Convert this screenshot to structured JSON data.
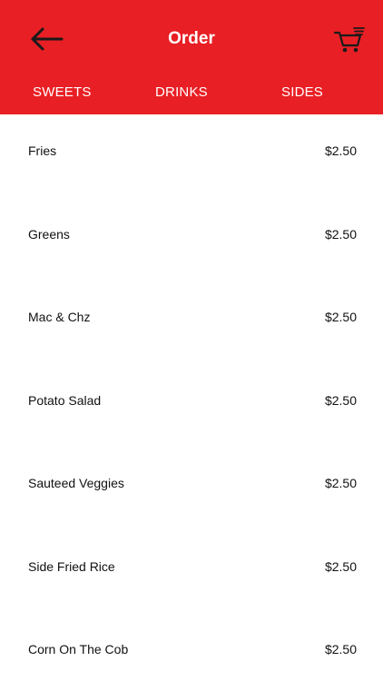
{
  "header": {
    "title": "Order",
    "background_color": "#e81f24",
    "back_icon": "arrow-left-icon",
    "cart_icon": "shopping-cart-icon"
  },
  "tabs": [
    {
      "label": "SWEETS"
    },
    {
      "label": "DRINKS"
    },
    {
      "label": "SIDES"
    }
  ],
  "items": [
    {
      "name": "Fries",
      "price": "$2.50"
    },
    {
      "name": "Greens",
      "price": "$2.50"
    },
    {
      "name": "Mac & Chz",
      "price": "$2.50"
    },
    {
      "name": "Potato Salad",
      "price": "$2.50"
    },
    {
      "name": "Sauteed Veggies",
      "price": "$2.50"
    },
    {
      "name": "Side Fried Rice",
      "price": "$2.50"
    },
    {
      "name": "Corn On The Cob",
      "price": "$2.50"
    }
  ]
}
